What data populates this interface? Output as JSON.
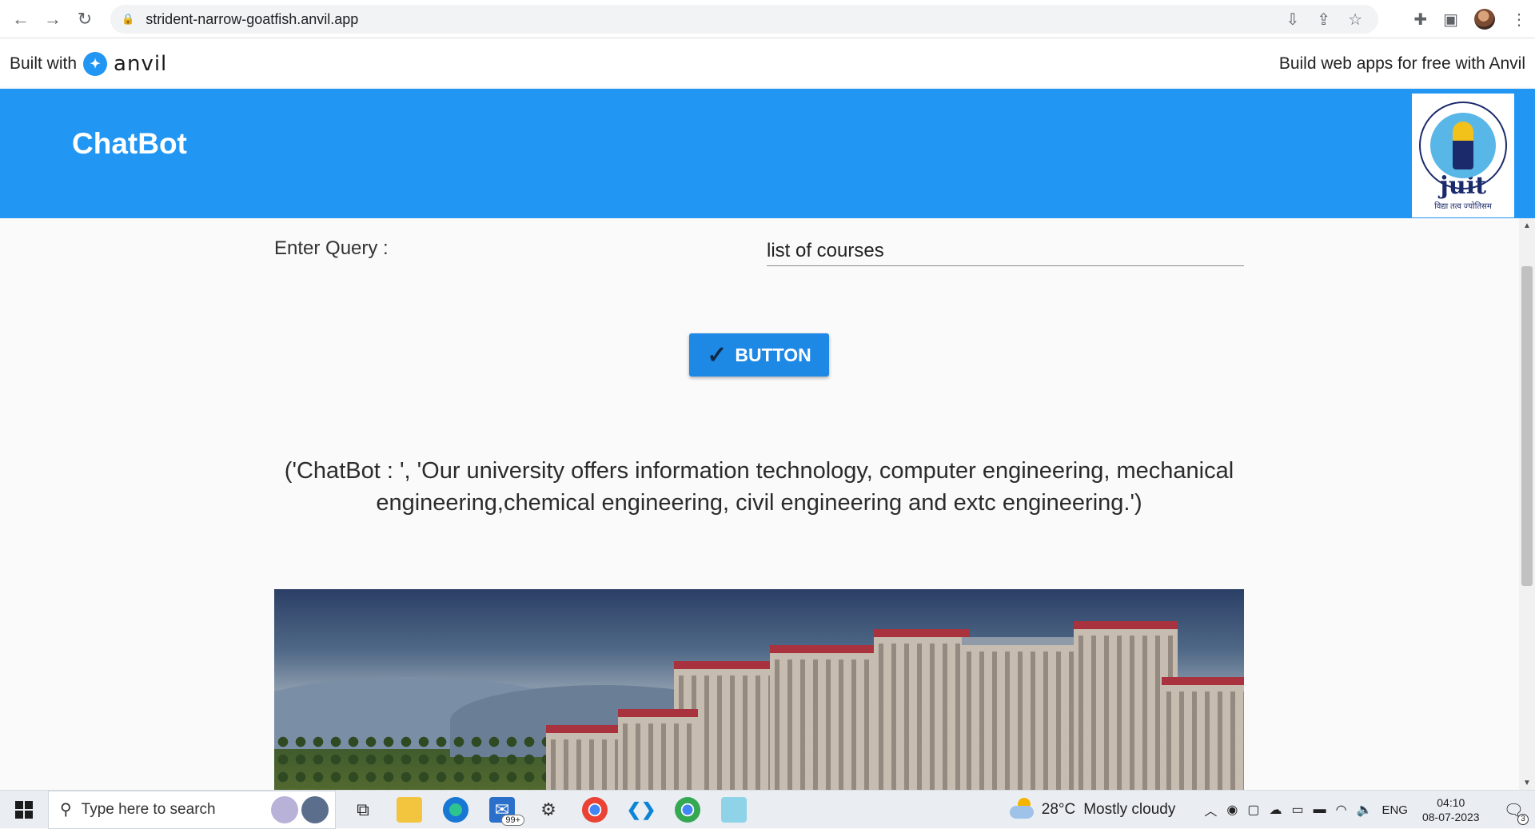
{
  "browser": {
    "url": "strident-narrow-goatfish.anvil.app",
    "back_glyph": "←",
    "forward_glyph": "→",
    "reload_glyph": "↻",
    "lock_glyph": "🔒"
  },
  "anvil_bar": {
    "built_with": "Built with",
    "brand": "anvil",
    "build_free": "Build web apps for free with Anvil"
  },
  "header": {
    "title": "ChatBot",
    "logo_text": "juit",
    "logo_sub": "विद्या तत्व ज्योतिसम"
  },
  "form": {
    "query_label": "Enter Query :",
    "query_value": "list of courses",
    "button_label": "BUTTON",
    "button_icon": "✓"
  },
  "response": {
    "text": "('ChatBot : ', 'Our university offers information technology, computer engineering, mechanical engineering,chemical engineering, civil engineering and extc engineering.')"
  },
  "taskbar": {
    "search_placeholder": "Type here to search",
    "mail_badge": "99+",
    "weather_temp": "28°C",
    "weather_desc": "Mostly cloudy",
    "language": "ENG",
    "time": "04:10",
    "date": "08-07-2023",
    "notification_count": "3"
  },
  "colors": {
    "header_blue": "#2196f3",
    "button_blue": "#1e88e5"
  }
}
